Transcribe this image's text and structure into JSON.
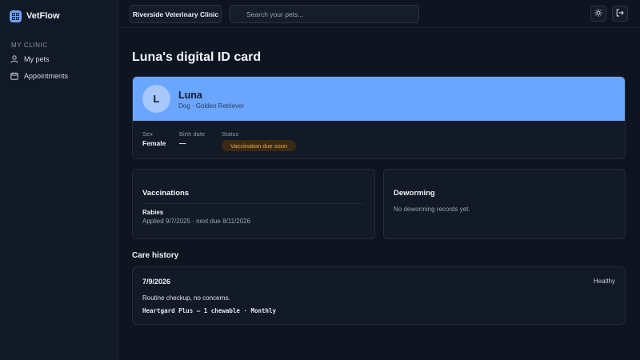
{
  "app": {
    "name": "VetFlow"
  },
  "sidebar": {
    "section_label": "MY CLINIC",
    "items": [
      {
        "label": "My pets",
        "icon": "person-icon"
      },
      {
        "label": "Appointments",
        "icon": "calendar-icon"
      }
    ]
  },
  "topbar": {
    "clinic": "Riverside Veterinary Clinic",
    "search_placeholder": "Search your pets...",
    "theme_icon": "sun-icon",
    "logout_icon": "logout-icon"
  },
  "page": {
    "title": "Luna's digital ID card"
  },
  "id_card": {
    "avatar_initial": "L",
    "name": "Luna",
    "species_breed": "Dog · Golden Retriever",
    "fields": {
      "sex_label": "Sex",
      "sex_value": "Female",
      "birth_label": "Birth date",
      "birth_value": "—",
      "status_label": "Status",
      "status_value": "Vaccination due soon"
    }
  },
  "vaccinations": {
    "title": "Vaccinations",
    "items": [
      {
        "name": "Rabies",
        "detail": "Applied 9/7/2025 · next due 8/11/2026"
      }
    ]
  },
  "deworming": {
    "title": "Deworming",
    "empty_text": "No deworming records yet."
  },
  "care_history": {
    "title": "Care history",
    "entries": [
      {
        "date": "7/9/2026",
        "status": "Healthy",
        "note": "Routine checkup, no concerns.",
        "medication": "Heartgard Plus — 1 chewable · Monthly"
      }
    ]
  },
  "colors": {
    "accent": "#6aa5ff",
    "background": "#0e1420",
    "warning": "#f0a64a"
  }
}
